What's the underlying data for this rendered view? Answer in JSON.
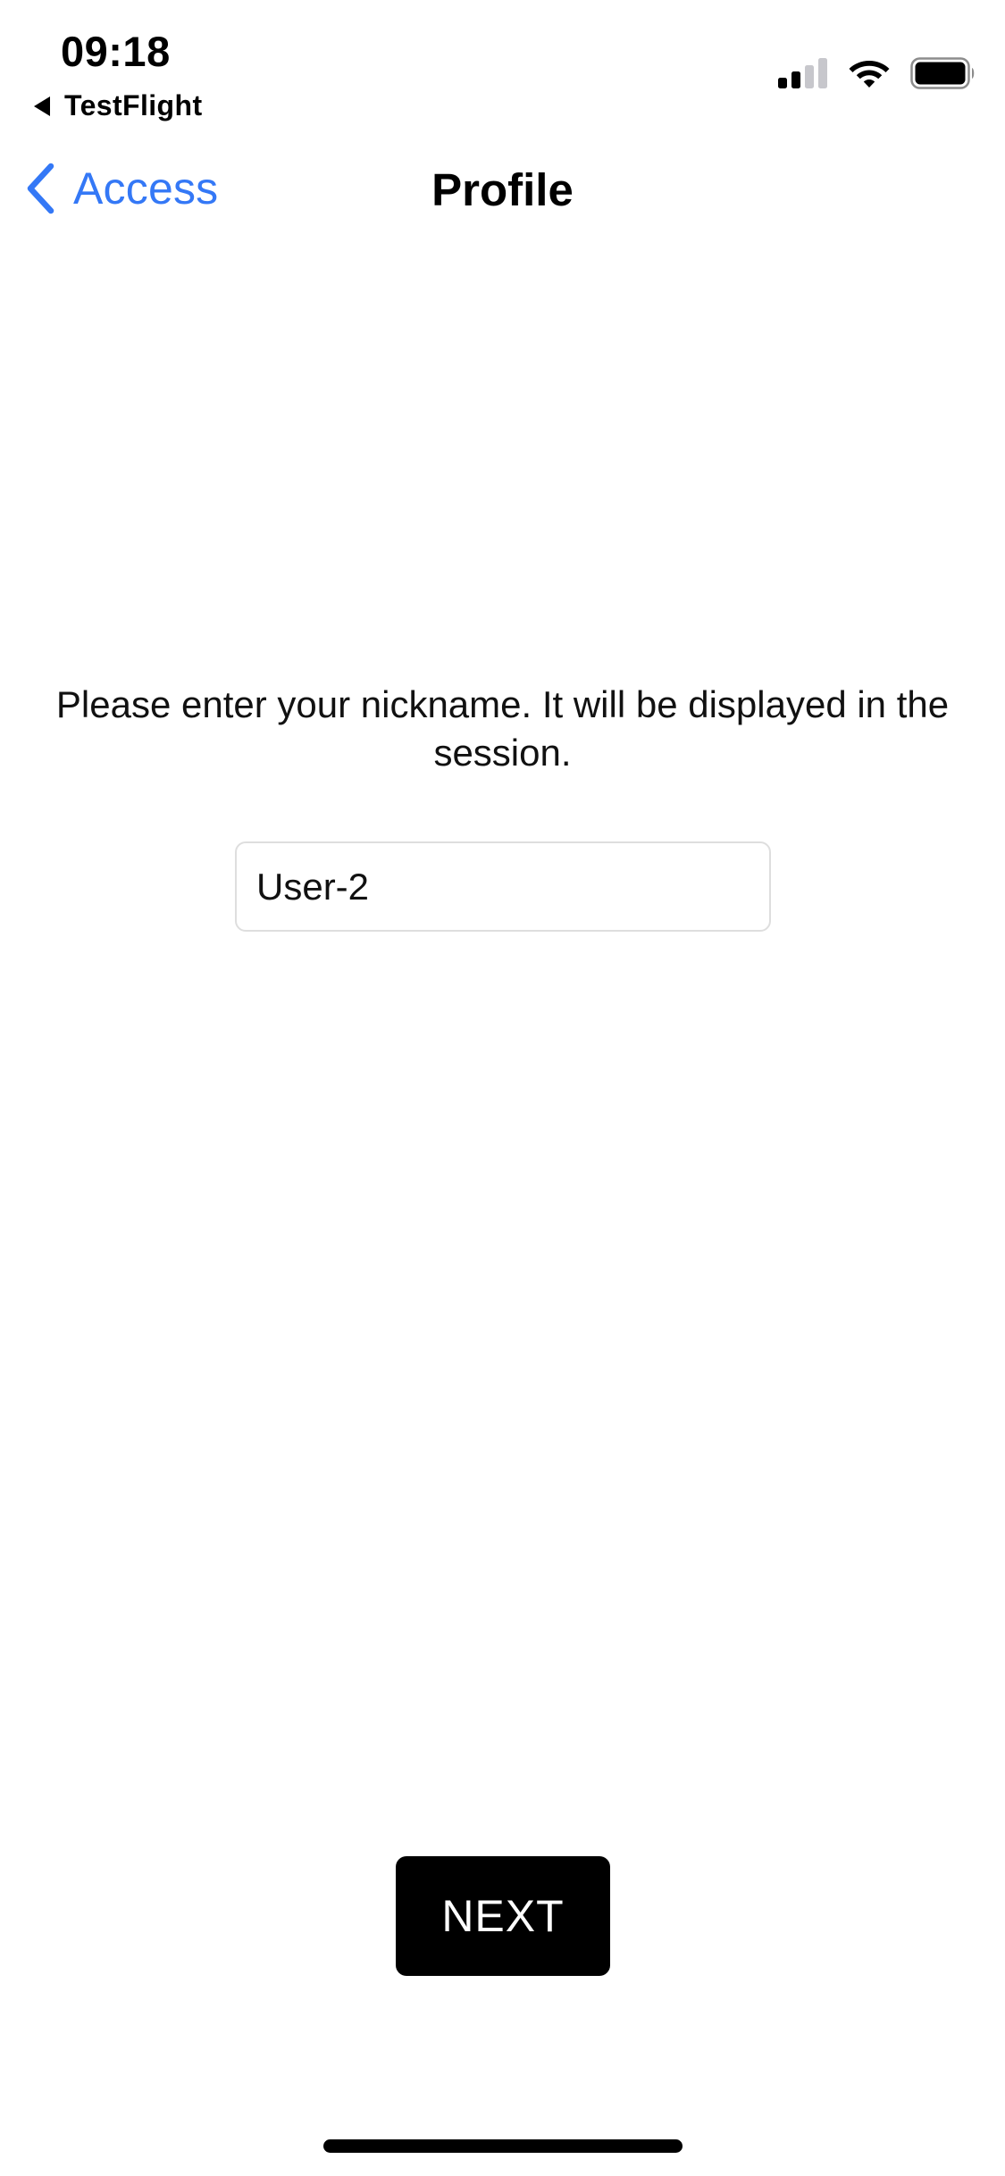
{
  "status_bar": {
    "time": "09:18",
    "back_app_label": "TestFlight",
    "signal_icon": "cellular-signal-icon",
    "wifi_icon": "wifi-icon",
    "battery_icon": "battery-icon",
    "signal_bars_active": 2,
    "signal_bars_total": 4
  },
  "nav": {
    "back_label": "Access",
    "title": "Profile",
    "accent_color": "#3478f6"
  },
  "content": {
    "prompt": "Please enter your nickname. It will be displayed in the session.",
    "nickname_value": "User-2"
  },
  "footer": {
    "next_label": "NEXT"
  }
}
